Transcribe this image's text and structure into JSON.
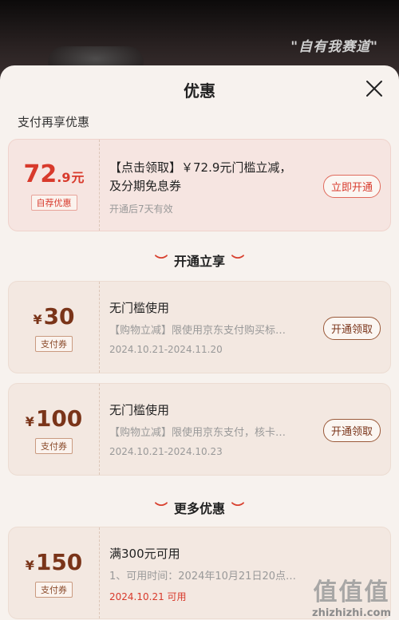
{
  "background": {
    "slogan": "\"自有我赛道\""
  },
  "sheet": {
    "title": "优惠",
    "section_label": "支付再享优惠"
  },
  "highlight_coupon": {
    "amount_int": "72",
    "amount_dec": ".9",
    "unit": "元",
    "badge": "自荐优惠",
    "title_1": "【点击领取】￥72.9元门槛立减，",
    "title_2": "及分期免息券",
    "note": "开通后7天有效",
    "button": "立即开通"
  },
  "divider_open": "开通立享",
  "open_coupons": [
    {
      "yen": "¥",
      "amount": "30",
      "badge": "支付券",
      "title": "无门槛使用",
      "desc": "【购物立减】限使用京东支付购买标…",
      "date": "2024.10.21-2024.11.20",
      "button": "开通领取"
    },
    {
      "yen": "¥",
      "amount": "100",
      "badge": "支付券",
      "title": "无门槛使用",
      "desc": "【购物立减】限使用京东支付，核卡…",
      "date": "2024.10.21-2024.10.23",
      "button": "开通领取"
    }
  ],
  "divider_more": "更多优惠",
  "more_coupons": [
    {
      "yen": "¥",
      "amount": "150",
      "badge": "支付券",
      "title": "满300元可用",
      "desc": "1、可用时间：2024年10月21日20点…",
      "date": "2024.10.21 可用"
    }
  ],
  "watermark": {
    "logo": "值值值",
    "site": "zhizhizhi.com"
  },
  "colors": {
    "accent_red": "#d83a2c",
    "brown": "#7a3419",
    "sheet_bg": "#f7f2ee"
  }
}
